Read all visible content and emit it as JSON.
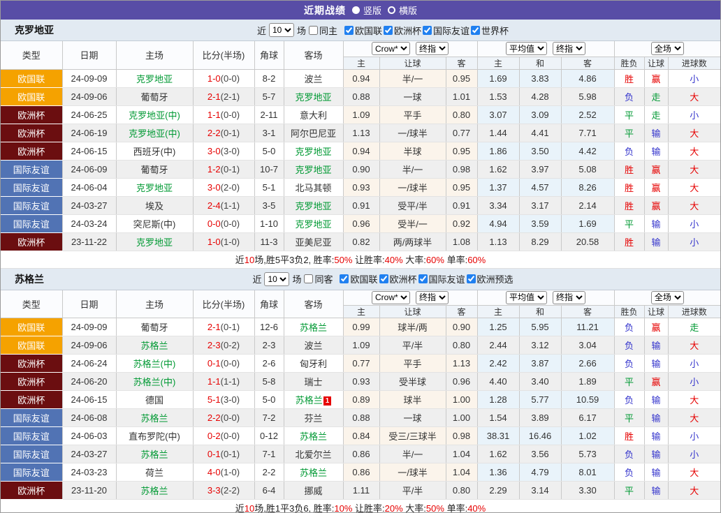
{
  "title_bar": {
    "title": "近期战绩",
    "vertical_label": "竖版",
    "horizontal_label": "横版",
    "vertical_selected": true
  },
  "colors": {
    "purple": "#584da6",
    "green": "#009933",
    "red": "#e60000",
    "blue": "#3333cc",
    "type": {
      "欧国联": "#f5a200",
      "欧洲杯": "#6b0e10",
      "国际友谊": "#5173b4"
    }
  },
  "table_header": {
    "left_cols": [
      "类型",
      "日期",
      "主场",
      "比分(半场)",
      "角球",
      "客场"
    ],
    "selects_crow": [
      "Crow*",
      "终指"
    ],
    "selects_avg": [
      "平均值",
      "终指"
    ],
    "selects_full": [
      "全场"
    ],
    "sub_cols": [
      "主",
      "让球",
      "客",
      "主",
      "和",
      "客",
      "胜负",
      "让球",
      "进球数"
    ]
  },
  "sections": [
    {
      "team": "克罗地亚",
      "controls": {
        "near": "近",
        "count": "10",
        "games": "场",
        "same_side": "同主",
        "same_checked": false,
        "leagues": [
          "欧国联",
          "欧洲杯",
          "国际友谊",
          "世界杯"
        ]
      },
      "rows": [
        {
          "type": "欧国联",
          "date": "24-09-09",
          "home": "克罗地亚",
          "home_hl": true,
          "score": "1-0",
          "half": "(0-0)",
          "corner": "8-2",
          "away": "波兰",
          "away_hl": false,
          "crow": [
            "0.94",
            "半/一",
            "0.95"
          ],
          "avg": [
            "1.69",
            "3.83",
            "4.86"
          ],
          "res": [
            {
              "t": "胜",
              "c": "red"
            },
            {
              "t": "赢",
              "c": "red"
            },
            {
              "t": "小",
              "c": "blue"
            }
          ]
        },
        {
          "type": "欧国联",
          "date": "24-09-06",
          "home": "葡萄牙",
          "home_hl": false,
          "score": "2-1",
          "half": "(2-1)",
          "corner": "5-7",
          "away": "克罗地亚",
          "away_hl": true,
          "crow": [
            "0.88",
            "一球",
            "1.01"
          ],
          "avg": [
            "1.53",
            "4.28",
            "5.98"
          ],
          "res": [
            {
              "t": "负",
              "c": "blue"
            },
            {
              "t": "走",
              "c": "green"
            },
            {
              "t": "大",
              "c": "red"
            }
          ]
        },
        {
          "type": "欧洲杯",
          "date": "24-06-25",
          "home": "克罗地亚(中)",
          "home_hl": true,
          "score": "1-1",
          "half": "(0-0)",
          "corner": "2-11",
          "away": "意大利",
          "away_hl": false,
          "crow": [
            "1.09",
            "平手",
            "0.80"
          ],
          "avg": [
            "3.07",
            "3.09",
            "2.52"
          ],
          "res": [
            {
              "t": "平",
              "c": "green"
            },
            {
              "t": "走",
              "c": "green"
            },
            {
              "t": "小",
              "c": "blue"
            }
          ]
        },
        {
          "type": "欧洲杯",
          "date": "24-06-19",
          "home": "克罗地亚(中)",
          "home_hl": true,
          "score": "2-2",
          "half": "(0-1)",
          "corner": "3-1",
          "away": "阿尔巴尼亚",
          "away_hl": false,
          "crow": [
            "1.13",
            "一/球半",
            "0.77"
          ],
          "avg": [
            "1.44",
            "4.41",
            "7.71"
          ],
          "res": [
            {
              "t": "平",
              "c": "green"
            },
            {
              "t": "输",
              "c": "blue"
            },
            {
              "t": "大",
              "c": "red"
            }
          ]
        },
        {
          "type": "欧洲杯",
          "date": "24-06-15",
          "home": "西班牙(中)",
          "home_hl": false,
          "score": "3-0",
          "half": "(3-0)",
          "corner": "5-0",
          "away": "克罗地亚",
          "away_hl": true,
          "crow": [
            "0.94",
            "半球",
            "0.95"
          ],
          "avg": [
            "1.86",
            "3.50",
            "4.42"
          ],
          "res": [
            {
              "t": "负",
              "c": "blue"
            },
            {
              "t": "输",
              "c": "blue"
            },
            {
              "t": "大",
              "c": "red"
            }
          ]
        },
        {
          "type": "国际友谊",
          "date": "24-06-09",
          "home": "葡萄牙",
          "home_hl": false,
          "score": "1-2",
          "half": "(0-1)",
          "corner": "10-7",
          "away": "克罗地亚",
          "away_hl": true,
          "crow": [
            "0.90",
            "半/一",
            "0.98"
          ],
          "avg": [
            "1.62",
            "3.97",
            "5.08"
          ],
          "res": [
            {
              "t": "胜",
              "c": "red"
            },
            {
              "t": "赢",
              "c": "red"
            },
            {
              "t": "大",
              "c": "red"
            }
          ]
        },
        {
          "type": "国际友谊",
          "date": "24-06-04",
          "home": "克罗地亚",
          "home_hl": true,
          "score": "3-0",
          "half": "(2-0)",
          "corner": "5-1",
          "away": "北马其顿",
          "away_hl": false,
          "crow": [
            "0.93",
            "一/球半",
            "0.95"
          ],
          "avg": [
            "1.37",
            "4.57",
            "8.26"
          ],
          "res": [
            {
              "t": "胜",
              "c": "red"
            },
            {
              "t": "赢",
              "c": "red"
            },
            {
              "t": "大",
              "c": "red"
            }
          ]
        },
        {
          "type": "国际友谊",
          "date": "24-03-27",
          "home": "埃及",
          "home_hl": false,
          "score": "2-4",
          "half": "(1-1)",
          "corner": "3-5",
          "away": "克罗地亚",
          "away_hl": true,
          "crow": [
            "0.91",
            "受平/半",
            "0.91"
          ],
          "avg": [
            "3.34",
            "3.17",
            "2.14"
          ],
          "res": [
            {
              "t": "胜",
              "c": "red"
            },
            {
              "t": "赢",
              "c": "red"
            },
            {
              "t": "大",
              "c": "red"
            }
          ]
        },
        {
          "type": "国际友谊",
          "date": "24-03-24",
          "home": "突尼斯(中)",
          "home_hl": false,
          "score": "0-0",
          "half": "(0-0)",
          "corner": "1-10",
          "away": "克罗地亚",
          "away_hl": true,
          "crow": [
            "0.96",
            "受半/一",
            "0.92"
          ],
          "avg": [
            "4.94",
            "3.59",
            "1.69"
          ],
          "res": [
            {
              "t": "平",
              "c": "green"
            },
            {
              "t": "输",
              "c": "blue"
            },
            {
              "t": "小",
              "c": "blue"
            }
          ]
        },
        {
          "type": "欧洲杯",
          "date": "23-11-22",
          "home": "克罗地亚",
          "home_hl": true,
          "score": "1-0",
          "half": "(1-0)",
          "corner": "11-3",
          "away": "亚美尼亚",
          "away_hl": false,
          "crow": [
            "0.82",
            "两/两球半",
            "1.08"
          ],
          "avg": [
            "1.13",
            "8.29",
            "20.58"
          ],
          "res": [
            {
              "t": "胜",
              "c": "red"
            },
            {
              "t": "输",
              "c": "blue"
            },
            {
              "t": "小",
              "c": "blue"
            }
          ]
        }
      ],
      "summary": [
        {
          "t": "近"
        },
        {
          "t": "10",
          "red": true
        },
        {
          "t": "场,胜5平3负2, 胜率:"
        },
        {
          "t": "50%",
          "red": true
        },
        {
          "t": " 让胜率:"
        },
        {
          "t": "40%",
          "red": true
        },
        {
          "t": " 大率:"
        },
        {
          "t": "60%",
          "red": true
        },
        {
          "t": " 单率:"
        },
        {
          "t": "60%",
          "red": true
        }
      ]
    },
    {
      "team": "苏格兰",
      "controls": {
        "near": "近",
        "count": "10",
        "games": "场",
        "same_side": "同客",
        "same_checked": false,
        "leagues": [
          "欧国联",
          "欧洲杯",
          "国际友谊",
          "欧洲预选"
        ]
      },
      "rows": [
        {
          "type": "欧国联",
          "date": "24-09-09",
          "home": "葡萄牙",
          "home_hl": false,
          "score": "2-1",
          "half": "(0-1)",
          "corner": "12-6",
          "away": "苏格兰",
          "away_hl": true,
          "crow": [
            "0.99",
            "球半/两",
            "0.90"
          ],
          "avg": [
            "1.25",
            "5.95",
            "11.21"
          ],
          "res": [
            {
              "t": "负",
              "c": "blue"
            },
            {
              "t": "赢",
              "c": "red"
            },
            {
              "t": "走",
              "c": "green"
            }
          ]
        },
        {
          "type": "欧国联",
          "date": "24-09-06",
          "home": "苏格兰",
          "home_hl": true,
          "score": "2-3",
          "half": "(0-2)",
          "corner": "2-3",
          "away": "波兰",
          "away_hl": false,
          "crow": [
            "1.09",
            "平/半",
            "0.80"
          ],
          "avg": [
            "2.44",
            "3.12",
            "3.04"
          ],
          "res": [
            {
              "t": "负",
              "c": "blue"
            },
            {
              "t": "输",
              "c": "blue"
            },
            {
              "t": "大",
              "c": "red"
            }
          ]
        },
        {
          "type": "欧洲杯",
          "date": "24-06-24",
          "home": "苏格兰(中)",
          "home_hl": true,
          "score": "0-1",
          "half": "(0-0)",
          "corner": "2-6",
          "away": "匈牙利",
          "away_hl": false,
          "crow": [
            "0.77",
            "平手",
            "1.13"
          ],
          "avg": [
            "2.42",
            "3.87",
            "2.66"
          ],
          "res": [
            {
              "t": "负",
              "c": "blue"
            },
            {
              "t": "输",
              "c": "blue"
            },
            {
              "t": "小",
              "c": "blue"
            }
          ]
        },
        {
          "type": "欧洲杯",
          "date": "24-06-20",
          "home": "苏格兰(中)",
          "home_hl": true,
          "score": "1-1",
          "half": "(1-1)",
          "corner": "5-8",
          "away": "瑞士",
          "away_hl": false,
          "crow": [
            "0.93",
            "受半球",
            "0.96"
          ],
          "avg": [
            "4.40",
            "3.40",
            "1.89"
          ],
          "res": [
            {
              "t": "平",
              "c": "green"
            },
            {
              "t": "赢",
              "c": "red"
            },
            {
              "t": "小",
              "c": "blue"
            }
          ]
        },
        {
          "type": "欧洲杯",
          "date": "24-06-15",
          "home": "德国",
          "home_hl": false,
          "score": "5-1",
          "half": "(3-0)",
          "corner": "5-0",
          "away": "苏格兰",
          "away_hl": true,
          "away_card": "1",
          "crow": [
            "0.89",
            "球半",
            "1.00"
          ],
          "avg": [
            "1.28",
            "5.77",
            "10.59"
          ],
          "res": [
            {
              "t": "负",
              "c": "blue"
            },
            {
              "t": "输",
              "c": "blue"
            },
            {
              "t": "大",
              "c": "red"
            }
          ]
        },
        {
          "type": "国际友谊",
          "date": "24-06-08",
          "home": "苏格兰",
          "home_hl": true,
          "score": "2-2",
          "half": "(0-0)",
          "corner": "7-2",
          "away": "芬兰",
          "away_hl": false,
          "crow": [
            "0.88",
            "一球",
            "1.00"
          ],
          "avg": [
            "1.54",
            "3.89",
            "6.17"
          ],
          "res": [
            {
              "t": "平",
              "c": "green"
            },
            {
              "t": "输",
              "c": "blue"
            },
            {
              "t": "大",
              "c": "red"
            }
          ]
        },
        {
          "type": "国际友谊",
          "date": "24-06-03",
          "home": "直布罗陀(中)",
          "home_hl": false,
          "score": "0-2",
          "half": "(0-0)",
          "corner": "0-12",
          "away": "苏格兰",
          "away_hl": true,
          "crow": [
            "0.84",
            "受三/三球半",
            "0.98"
          ],
          "avg": [
            "38.31",
            "16.46",
            "1.02"
          ],
          "res": [
            {
              "t": "胜",
              "c": "red"
            },
            {
              "t": "输",
              "c": "blue"
            },
            {
              "t": "小",
              "c": "blue"
            }
          ]
        },
        {
          "type": "国际友谊",
          "date": "24-03-27",
          "home": "苏格兰",
          "home_hl": true,
          "score": "0-1",
          "half": "(0-1)",
          "corner": "7-1",
          "away": "北爱尔兰",
          "away_hl": false,
          "crow": [
            "0.86",
            "半/一",
            "1.04"
          ],
          "avg": [
            "1.62",
            "3.56",
            "5.73"
          ],
          "res": [
            {
              "t": "负",
              "c": "blue"
            },
            {
              "t": "输",
              "c": "blue"
            },
            {
              "t": "小",
              "c": "blue"
            }
          ]
        },
        {
          "type": "国际友谊",
          "date": "24-03-23",
          "home": "荷兰",
          "home_hl": false,
          "score": "4-0",
          "half": "(1-0)",
          "corner": "2-2",
          "away": "苏格兰",
          "away_hl": true,
          "crow": [
            "0.86",
            "一/球半",
            "1.04"
          ],
          "avg": [
            "1.36",
            "4.79",
            "8.01"
          ],
          "res": [
            {
              "t": "负",
              "c": "blue"
            },
            {
              "t": "输",
              "c": "blue"
            },
            {
              "t": "大",
              "c": "red"
            }
          ]
        },
        {
          "type": "欧洲杯",
          "date": "23-11-20",
          "home": "苏格兰",
          "home_hl": true,
          "score": "3-3",
          "half": "(2-2)",
          "corner": "6-4",
          "away": "挪威",
          "away_hl": false,
          "crow": [
            "1.11",
            "平/半",
            "0.80"
          ],
          "avg": [
            "2.29",
            "3.14",
            "3.30"
          ],
          "res": [
            {
              "t": "平",
              "c": "green"
            },
            {
              "t": "输",
              "c": "blue"
            },
            {
              "t": "大",
              "c": "red"
            }
          ]
        }
      ],
      "summary": [
        {
          "t": "近"
        },
        {
          "t": "10",
          "red": true
        },
        {
          "t": "场,胜1平3负6, 胜率:"
        },
        {
          "t": "10%",
          "red": true
        },
        {
          "t": " 让胜率:"
        },
        {
          "t": "20%",
          "red": true
        },
        {
          "t": " 大率:"
        },
        {
          "t": "50%",
          "red": true
        },
        {
          "t": " 单率:"
        },
        {
          "t": "40%",
          "red": true
        }
      ]
    }
  ]
}
